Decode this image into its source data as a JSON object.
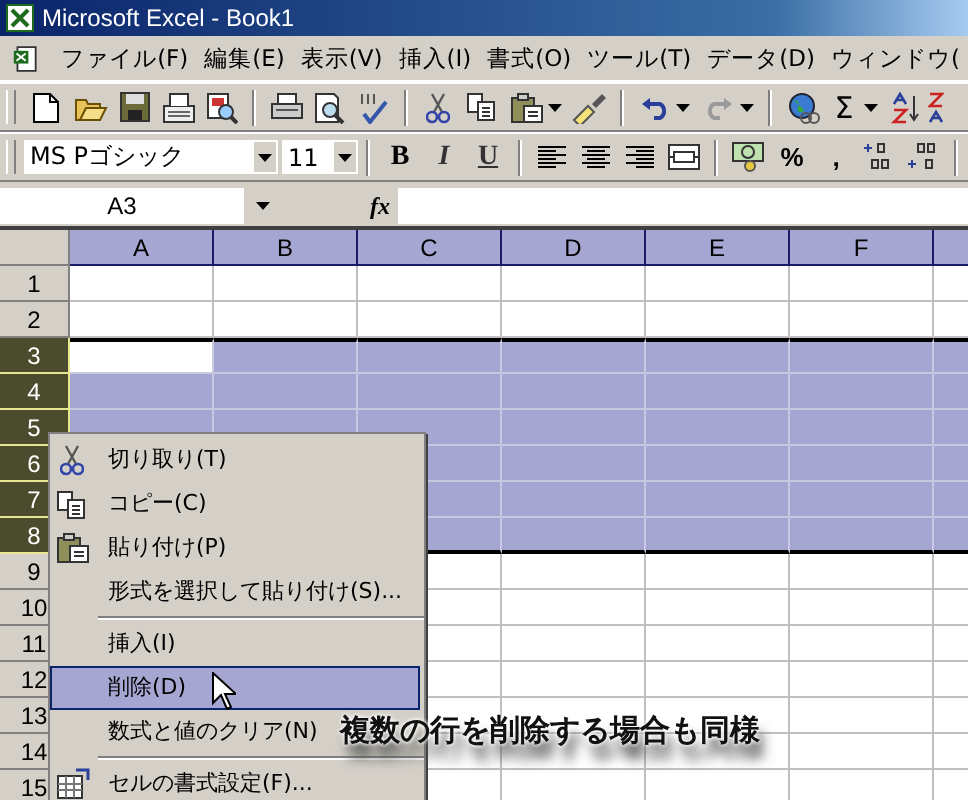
{
  "window": {
    "title": "Microsoft Excel - Book1"
  },
  "menu_bar": [
    "ファイル(F)",
    "編集(E)",
    "表示(V)",
    "挿入(I)",
    "書式(O)",
    "ツール(T)",
    "データ(D)",
    "ウィンドウ("
  ],
  "standard_toolbar": {
    "sum_symbol": "Σ",
    "redo_disabled": true
  },
  "formatting_toolbar": {
    "font": "MS Pゴシック",
    "size": "11",
    "bold": "B",
    "italic": "I",
    "underline": "U",
    "percent": "%",
    "comma": ","
  },
  "formula_bar": {
    "name_box": "A3",
    "fx": "fx"
  },
  "columns": [
    {
      "label": "A",
      "highlighted": true
    },
    {
      "label": "B",
      "highlighted": true
    },
    {
      "label": "C",
      "highlighted": true
    },
    {
      "label": "D",
      "highlighted": true
    },
    {
      "label": "E",
      "highlighted": true
    },
    {
      "label": "F",
      "highlighted": true
    }
  ],
  "rows": [
    {
      "label": "1",
      "selected": false
    },
    {
      "label": "2",
      "selected": false
    },
    {
      "label": "3",
      "selected": true,
      "active": true
    },
    {
      "label": "4",
      "selected": true
    },
    {
      "label": "5",
      "selected": true
    },
    {
      "label": "6",
      "selected": true
    },
    {
      "label": "7",
      "selected": true
    },
    {
      "label": "8",
      "selected": true
    },
    {
      "label": "9",
      "selected": false
    },
    {
      "label": "10",
      "selected": false
    },
    {
      "label": "11",
      "selected": false
    },
    {
      "label": "12",
      "selected": false
    },
    {
      "label": "13",
      "selected": false
    },
    {
      "label": "14",
      "selected": false
    },
    {
      "label": "15",
      "selected": false
    }
  ],
  "context_menu": [
    {
      "kind": "item",
      "label": "切り取り(T)",
      "selected": false
    },
    {
      "kind": "item",
      "label": "コピー(C)",
      "selected": false
    },
    {
      "kind": "item",
      "label": "貼り付け(P)",
      "selected": false
    },
    {
      "kind": "item",
      "label": "形式を選択して貼り付け(S)...",
      "selected": false
    },
    {
      "kind": "separator"
    },
    {
      "kind": "item",
      "label": "挿入(I)",
      "selected": false
    },
    {
      "kind": "item",
      "label": "削除(D)",
      "selected": true
    },
    {
      "kind": "item",
      "label": "数式と値のクリア(N)",
      "selected": false
    },
    {
      "kind": "separator"
    },
    {
      "kind": "item",
      "label": "セルの書式設定(F)...",
      "selected": false
    }
  ],
  "annotation": "複数の行を削除する場合も同様"
}
